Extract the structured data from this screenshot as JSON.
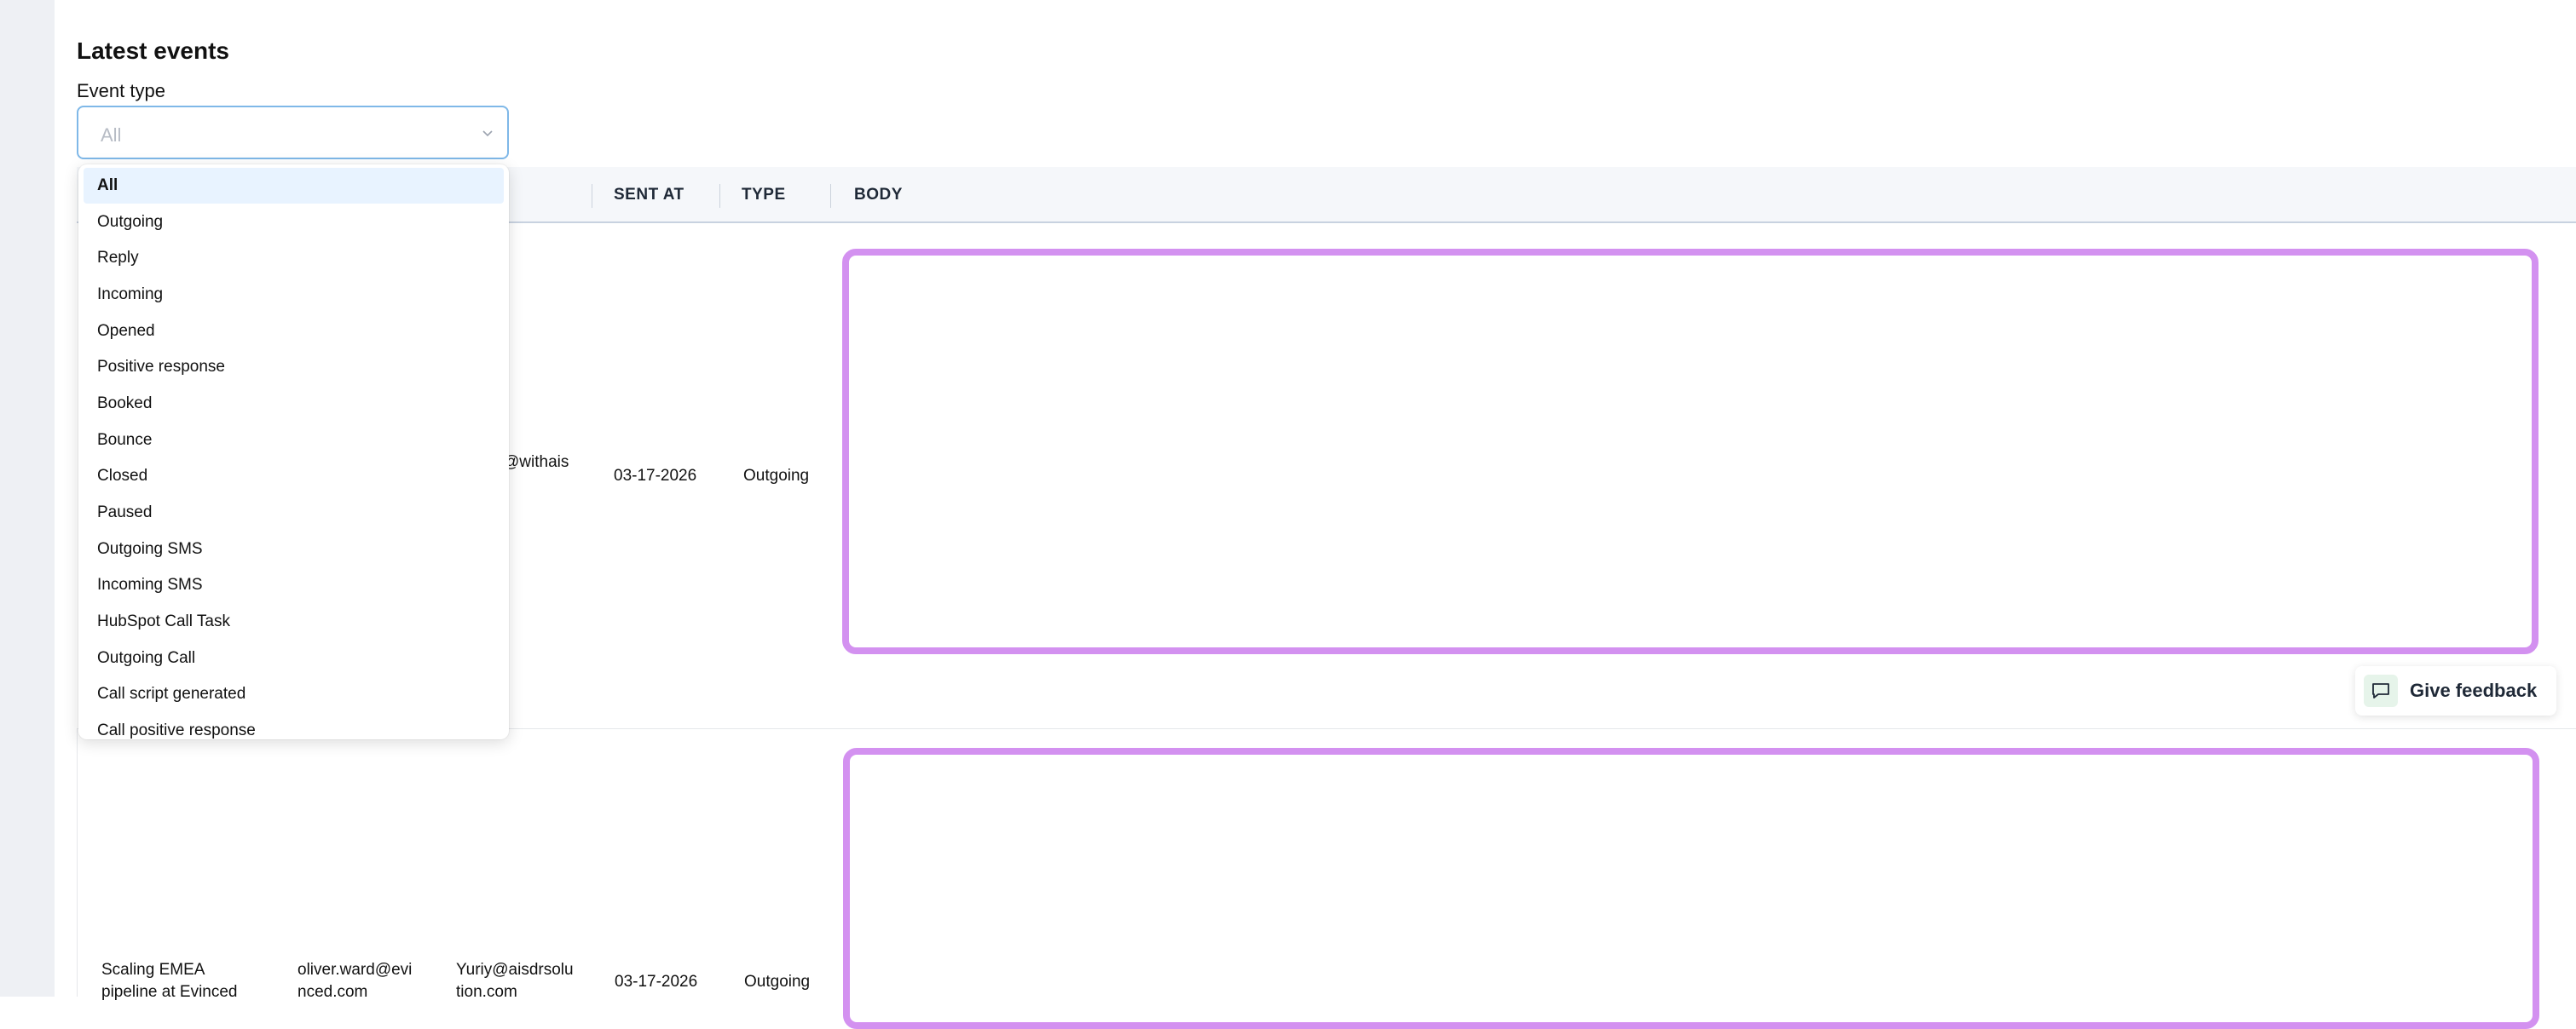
{
  "section": {
    "title": "Latest events"
  },
  "filter": {
    "label": "Event type",
    "selected": "All",
    "options": [
      "All",
      "Outgoing",
      "Reply",
      "Incoming",
      "Opened",
      "Positive response",
      "Booked",
      "Bounce",
      "Closed",
      "Paused",
      "Outgoing SMS",
      "Incoming SMS",
      "HubSpot Call Task",
      "Outgoing Call",
      "Call script generated",
      "Call positive response"
    ]
  },
  "table": {
    "columns": {
      "sent_at": "SENT AT",
      "type": "TYPE",
      "body": "BODY"
    },
    "rows": [
      {
        "partial_to": "@withais",
        "sent_at": "03-17-2026",
        "type": "Outgoing"
      },
      {
        "subject_line1": "Scaling EMEA",
        "subject_line2": "pipeline at Evinced",
        "from_line1": "oliver.ward@evi",
        "from_line2": "nced.com",
        "to_line1": "Yuriy@aisdrsolu",
        "to_line2": "tion.com",
        "sent_at": "03-17-2026",
        "type": "Outgoing"
      }
    ]
  },
  "feedback": {
    "label": "Give feedback"
  },
  "colors": {
    "accent_border": "#d391f0",
    "select_focus": "#7fb8e8",
    "selected_option_bg": "#e8f3ff"
  }
}
